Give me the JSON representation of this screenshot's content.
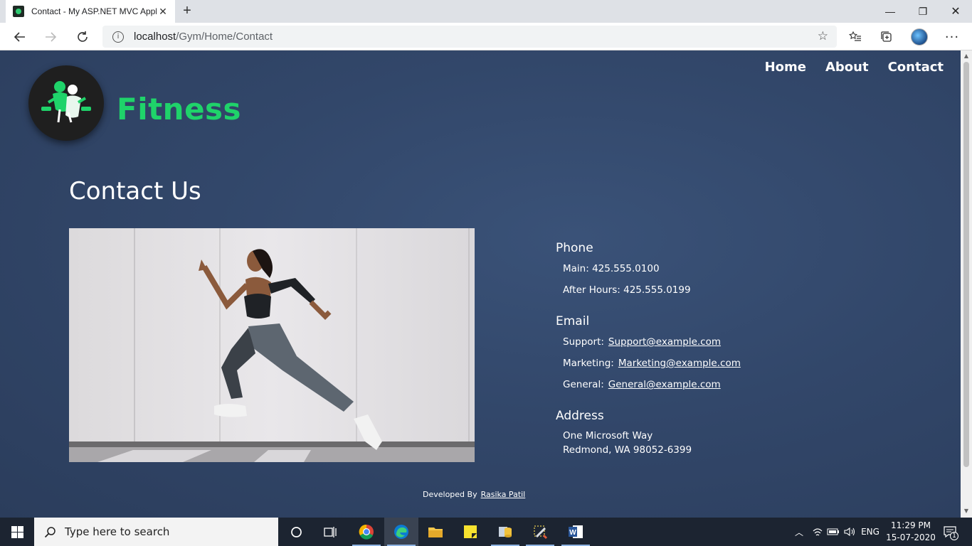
{
  "browser": {
    "tab_title": "Contact - My ASP.NET MVC Application",
    "tab_close": "✕",
    "new_tab": "+",
    "url_host": "localhost",
    "url_path": "/Gym/Home/Contact",
    "window_controls": {
      "minimize": "—",
      "restore": "❐",
      "close": "✕"
    }
  },
  "site": {
    "brand": "Fitness",
    "nav": [
      "Home",
      "About",
      "Contact"
    ],
    "page_title": "Contact Us",
    "brand_color": "#1fd36a"
  },
  "contact": {
    "phone": {
      "heading": "Phone",
      "main": "Main: 425.555.0100",
      "after_hours": "After Hours: 425.555.0199"
    },
    "email": {
      "heading": "Email",
      "support_label": "Support:",
      "support_link": "Support@example.com",
      "marketing_label": "Marketing:",
      "marketing_link": "Marketing@example.com",
      "general_label": "General:",
      "general_link": "General@example.com"
    },
    "address": {
      "heading": "Address",
      "line1": "One Microsoft Way",
      "line2": "Redmond, WA 98052-6399"
    }
  },
  "footer": {
    "developed_by": "Developed By",
    "author": "Rasika Patil"
  },
  "taskbar": {
    "search_placeholder": "Type here to search",
    "language": "ENG",
    "time": "11:29 PM",
    "date": "15-07-2020",
    "notification_count": "1"
  }
}
